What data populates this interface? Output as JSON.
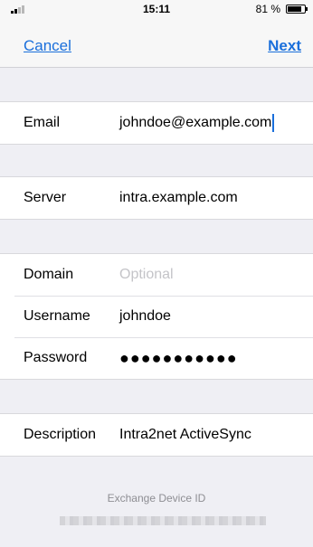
{
  "status_bar": {
    "time": "15:11",
    "battery": "81 %"
  },
  "nav": {
    "cancel": "Cancel",
    "next": "Next"
  },
  "account": {
    "email_label": "Email",
    "email_value": "johndoe@example.com",
    "server_label": "Server",
    "server_value": "intra.example.com",
    "domain_label": "Domain",
    "domain_placeholder": "Optional",
    "username_label": "Username",
    "username_value": "johndoe",
    "password_label": "Password",
    "password_value": "●●●●●●●●●●●",
    "description_label": "Description",
    "description_value": "Intra2net ActiveSync"
  },
  "footer": {
    "device_id_label": "Exchange Device ID"
  },
  "colors": {
    "accent": "#1a6fdb",
    "background": "#efeff4"
  }
}
